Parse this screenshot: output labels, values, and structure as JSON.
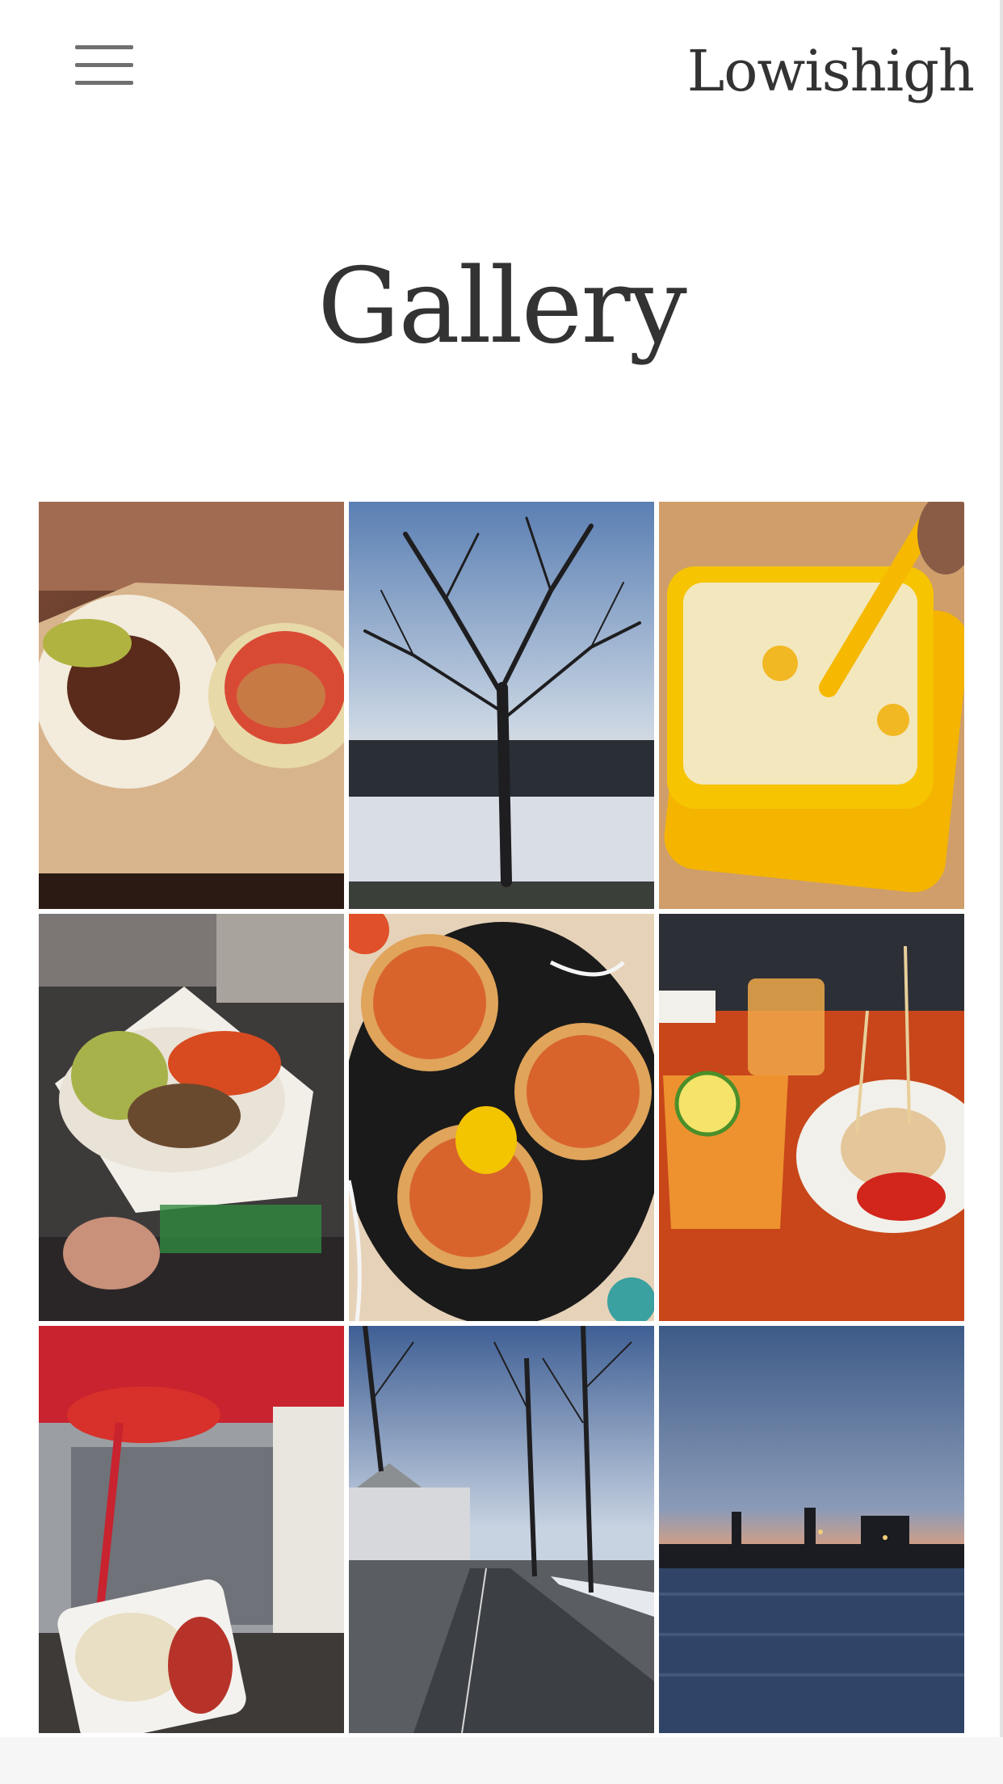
{
  "header": {
    "brand": "Lowishigh",
    "menu_icon": "hamburger-menu-icon"
  },
  "page": {
    "title": "Gallery"
  },
  "gallery": {
    "items": [
      {
        "label": "tacos-on-paper"
      },
      {
        "label": "bare-tree-snowy-field"
      },
      {
        "label": "yellow-bowl-dessert"
      },
      {
        "label": "falafel-wrap"
      },
      {
        "label": "tostadas-plate"
      },
      {
        "label": "drinks-and-tapas"
      },
      {
        "label": "curry-36-stand"
      },
      {
        "label": "tree-lined-road"
      },
      {
        "label": "river-sunset-skyline"
      }
    ]
  },
  "colors": {
    "text": "#333333",
    "icon": "#707070",
    "background": "#ffffff"
  }
}
